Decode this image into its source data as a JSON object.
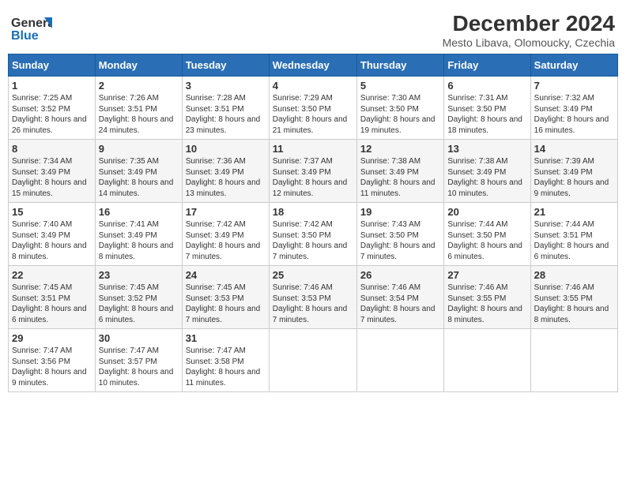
{
  "header": {
    "logo_line1": "General",
    "logo_line2": "Blue",
    "main_title": "December 2024",
    "subtitle": "Mesto Libava, Olomoucky, Czechia"
  },
  "calendar": {
    "days_of_week": [
      "Sunday",
      "Monday",
      "Tuesday",
      "Wednesday",
      "Thursday",
      "Friday",
      "Saturday"
    ],
    "weeks": [
      [
        null,
        {
          "day": 2,
          "sunrise": "7:26 AM",
          "sunset": "3:51 PM",
          "daylight": "8 hours and 24 minutes."
        },
        {
          "day": 3,
          "sunrise": "7:28 AM",
          "sunset": "3:51 PM",
          "daylight": "8 hours and 23 minutes."
        },
        {
          "day": 4,
          "sunrise": "7:29 AM",
          "sunset": "3:50 PM",
          "daylight": "8 hours and 21 minutes."
        },
        {
          "day": 5,
          "sunrise": "7:30 AM",
          "sunset": "3:50 PM",
          "daylight": "8 hours and 19 minutes."
        },
        {
          "day": 6,
          "sunrise": "7:31 AM",
          "sunset": "3:50 PM",
          "daylight": "8 hours and 18 minutes."
        },
        {
          "day": 7,
          "sunrise": "7:32 AM",
          "sunset": "3:49 PM",
          "daylight": "8 hours and 16 minutes."
        }
      ],
      [
        {
          "day": 1,
          "sunrise": "7:25 AM",
          "sunset": "3:52 PM",
          "daylight": "8 hours and 26 minutes."
        },
        {
          "day": 8,
          "sunrise": "7:34 AM",
          "sunset": "3:49 PM",
          "daylight": "8 hours and 15 minutes."
        },
        {
          "day": 9,
          "sunrise": "7:35 AM",
          "sunset": "3:49 PM",
          "daylight": "8 hours and 14 minutes."
        },
        {
          "day": 10,
          "sunrise": "7:36 AM",
          "sunset": "3:49 PM",
          "daylight": "8 hours and 13 minutes."
        },
        {
          "day": 11,
          "sunrise": "7:37 AM",
          "sunset": "3:49 PM",
          "daylight": "8 hours and 12 minutes."
        },
        {
          "day": 12,
          "sunrise": "7:38 AM",
          "sunset": "3:49 PM",
          "daylight": "8 hours and 11 minutes."
        },
        {
          "day": 13,
          "sunrise": "7:38 AM",
          "sunset": "3:49 PM",
          "daylight": "8 hours and 10 minutes."
        },
        {
          "day": 14,
          "sunrise": "7:39 AM",
          "sunset": "3:49 PM",
          "daylight": "8 hours and 9 minutes."
        }
      ],
      [
        {
          "day": 15,
          "sunrise": "7:40 AM",
          "sunset": "3:49 PM",
          "daylight": "8 hours and 8 minutes."
        },
        {
          "day": 16,
          "sunrise": "7:41 AM",
          "sunset": "3:49 PM",
          "daylight": "8 hours and 8 minutes."
        },
        {
          "day": 17,
          "sunrise": "7:42 AM",
          "sunset": "3:49 PM",
          "daylight": "8 hours and 7 minutes."
        },
        {
          "day": 18,
          "sunrise": "7:42 AM",
          "sunset": "3:50 PM",
          "daylight": "8 hours and 7 minutes."
        },
        {
          "day": 19,
          "sunrise": "7:43 AM",
          "sunset": "3:50 PM",
          "daylight": "8 hours and 7 minutes."
        },
        {
          "day": 20,
          "sunrise": "7:44 AM",
          "sunset": "3:50 PM",
          "daylight": "8 hours and 6 minutes."
        },
        {
          "day": 21,
          "sunrise": "7:44 AM",
          "sunset": "3:51 PM",
          "daylight": "8 hours and 6 minutes."
        }
      ],
      [
        {
          "day": 22,
          "sunrise": "7:45 AM",
          "sunset": "3:51 PM",
          "daylight": "8 hours and 6 minutes."
        },
        {
          "day": 23,
          "sunrise": "7:45 AM",
          "sunset": "3:52 PM",
          "daylight": "8 hours and 6 minutes."
        },
        {
          "day": 24,
          "sunrise": "7:45 AM",
          "sunset": "3:53 PM",
          "daylight": "8 hours and 7 minutes."
        },
        {
          "day": 25,
          "sunrise": "7:46 AM",
          "sunset": "3:53 PM",
          "daylight": "8 hours and 7 minutes."
        },
        {
          "day": 26,
          "sunrise": "7:46 AM",
          "sunset": "3:54 PM",
          "daylight": "8 hours and 7 minutes."
        },
        {
          "day": 27,
          "sunrise": "7:46 AM",
          "sunset": "3:55 PM",
          "daylight": "8 hours and 8 minutes."
        },
        {
          "day": 28,
          "sunrise": "7:46 AM",
          "sunset": "3:55 PM",
          "daylight": "8 hours and 8 minutes."
        }
      ],
      [
        {
          "day": 29,
          "sunrise": "7:47 AM",
          "sunset": "3:56 PM",
          "daylight": "8 hours and 9 minutes."
        },
        {
          "day": 30,
          "sunrise": "7:47 AM",
          "sunset": "3:57 PM",
          "daylight": "8 hours and 10 minutes."
        },
        {
          "day": 31,
          "sunrise": "7:47 AM",
          "sunset": "3:58 PM",
          "daylight": "8 hours and 11 minutes."
        },
        null,
        null,
        null,
        null
      ]
    ]
  }
}
